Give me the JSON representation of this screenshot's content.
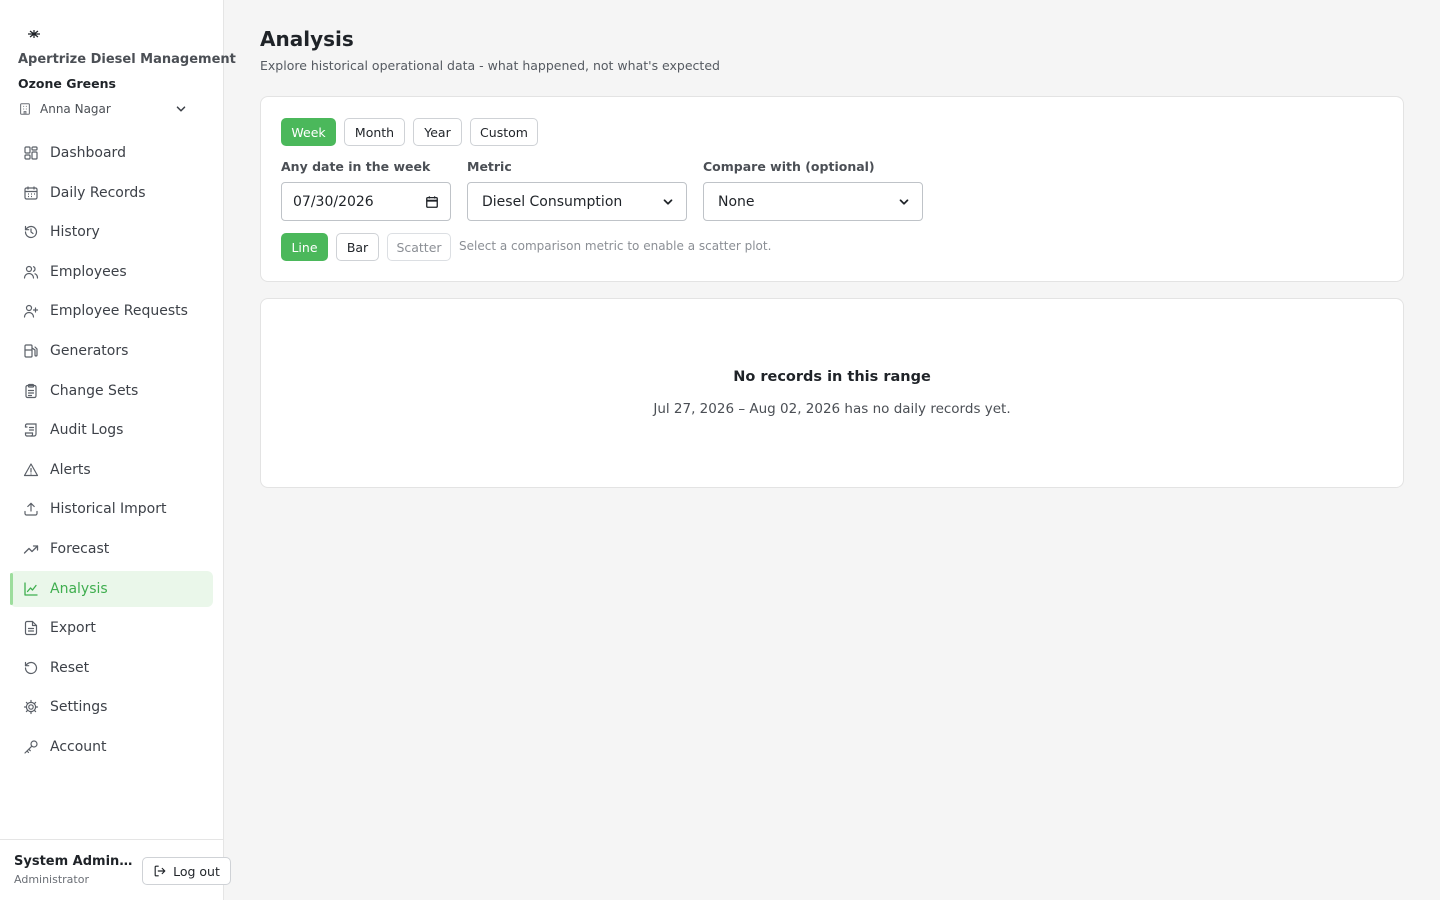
{
  "brand": {
    "app_name": "Apertrize Diesel Management",
    "org_name": "Ozone Greens",
    "site_name": "Anna Nagar"
  },
  "nav": {
    "items": [
      {
        "label": "Dashboard",
        "icon": "dashboard-icon"
      },
      {
        "label": "Daily Records",
        "icon": "calendar-icon"
      },
      {
        "label": "History",
        "icon": "history-icon"
      },
      {
        "label": "Employees",
        "icon": "users-icon"
      },
      {
        "label": "Employee Requests",
        "icon": "user-plus-icon"
      },
      {
        "label": "Generators",
        "icon": "fuel-pump-icon"
      },
      {
        "label": "Change Sets",
        "icon": "clipboard-icon"
      },
      {
        "label": "Audit Logs",
        "icon": "scroll-icon"
      },
      {
        "label": "Alerts",
        "icon": "alert-triangle-icon"
      },
      {
        "label": "Historical Import",
        "icon": "upload-icon"
      },
      {
        "label": "Forecast",
        "icon": "trending-up-icon"
      },
      {
        "label": "Analysis",
        "icon": "line-chart-icon"
      },
      {
        "label": "Export",
        "icon": "file-text-icon"
      },
      {
        "label": "Reset",
        "icon": "rotate-ccw-icon"
      },
      {
        "label": "Settings",
        "icon": "gear-icon"
      },
      {
        "label": "Account",
        "icon": "key-icon"
      }
    ],
    "active": "Analysis"
  },
  "user": {
    "name": "System Administrator",
    "role": "Administrator",
    "logout_label": "Log out"
  },
  "page": {
    "title": "Analysis",
    "subtitle": "Explore historical operational data - what happened, not what's expected"
  },
  "controls": {
    "periods": [
      "Week",
      "Month",
      "Year",
      "Custom"
    ],
    "active_period": "Week",
    "date_label": "Any date in the week",
    "date_value": "07/30/2026",
    "metric_label": "Metric",
    "metric_value": "Diesel Consumption",
    "compare_label": "Compare with (optional)",
    "compare_value": "None",
    "chart_types": [
      "Line",
      "Bar",
      "Scatter"
    ],
    "active_chart_type": "Line",
    "scatter_hint": "Select a comparison metric to enable a scatter plot."
  },
  "result": {
    "empty_title": "No records in this range",
    "empty_desc": "Jul 27, 2026 – Aug 02, 2026 has no daily records yet."
  },
  "colors": {
    "accent": "#4bb85b",
    "active_nav_bg": "#eaf7ea",
    "active_nav_text": "#3fae4f"
  }
}
